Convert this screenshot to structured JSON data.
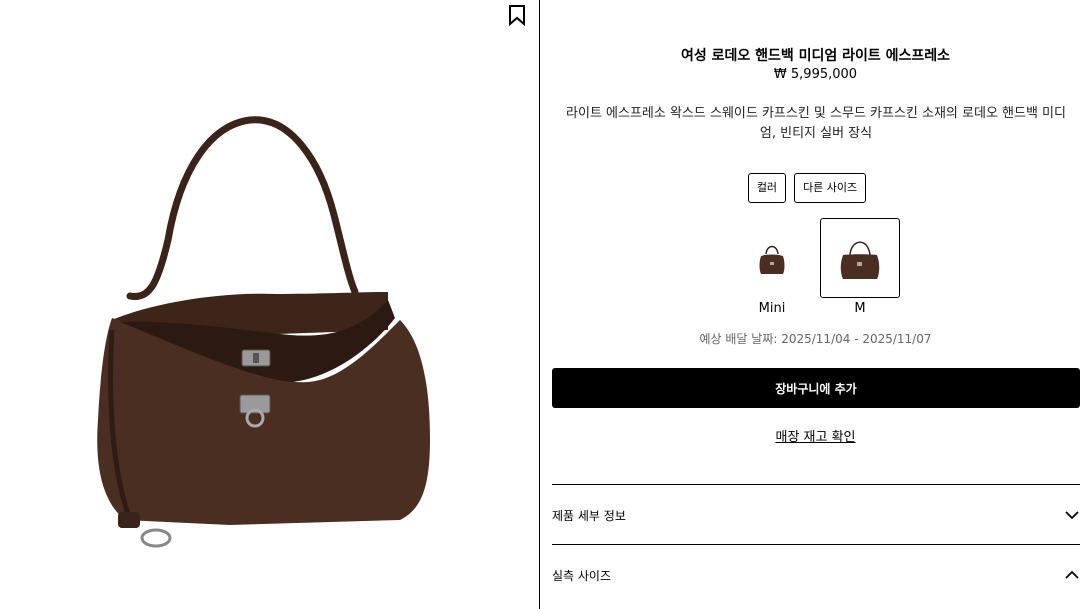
{
  "product": {
    "title": "여성 로데오 핸드백 미디엄 라이트 에스프레소",
    "price": "₩ 5,995,000",
    "description": "라이트 에스프레소 왁스드 스웨이드 카프스킨 및 스무드 카프스킨 소재의 로데오 핸드백 미디엄, 빈티지 실버 장식"
  },
  "tags": {
    "color": "컬러",
    "other_sizes": "다른 사이즈"
  },
  "variants": [
    {
      "label": "Mini",
      "selected": false
    },
    {
      "label": "M",
      "selected": true
    }
  ],
  "delivery": "예상 배달 날짜: 2025/11/04 - 2025/11/07",
  "cta": {
    "add_to_cart": "장바구니에 추가",
    "store_stock": "매장 재고 확인"
  },
  "accordions": [
    {
      "label": "제품 세부 정보",
      "icon": "chevron-down-icon"
    },
    {
      "label": "실측 사이즈",
      "icon": "chevron-up-icon"
    }
  ],
  "icons": {
    "bookmark": "bookmark-icon"
  },
  "colors": {
    "accent": "#000000",
    "bag": "#4a2e22",
    "background": "#ffffff"
  }
}
